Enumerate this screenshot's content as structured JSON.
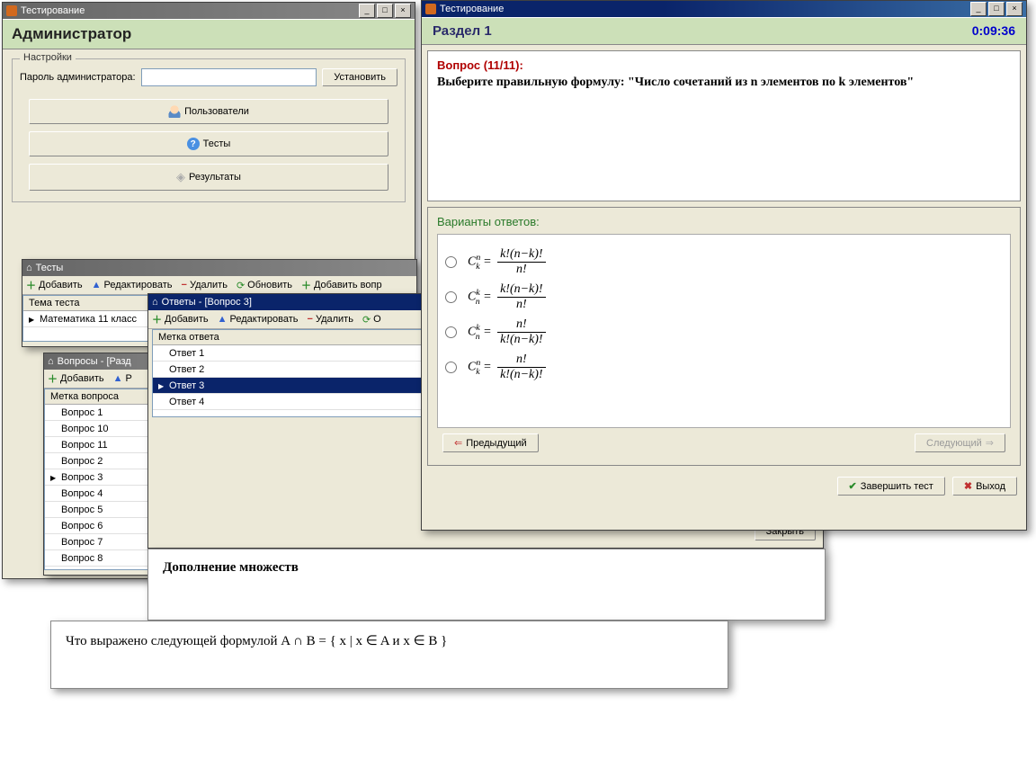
{
  "admin": {
    "title": "Тестирование",
    "header": "Администратор",
    "settings_group": "Настройки",
    "password_label": "Пароль администратора:",
    "set_btn": "Установить",
    "users_btn": "Пользователи",
    "tests_btn": "Тесты",
    "results_btn": "Результаты"
  },
  "tests": {
    "title": "Тесты",
    "tb_add": "Добавить",
    "tb_edit": "Редактировать",
    "tb_del": "Удалить",
    "tb_refresh": "Обновить",
    "tb_addq": "Добавить вопр",
    "col": "Тема теста",
    "row": "Математика 11 класс"
  },
  "questions": {
    "title": "Вопросы - [Разд",
    "tb_add": "Добавить",
    "tb_edit": "Р",
    "col": "Метка вопроса",
    "rows": [
      "Вопрос 1",
      "Вопрос 10",
      "Вопрос 11",
      "Вопрос 2",
      "Вопрос 3",
      "Вопрос 4",
      "Вопрос 5",
      "Вопрос 6",
      "Вопрос 7",
      "Вопрос 8"
    ],
    "selected": "Вопрос 3"
  },
  "answers_win": {
    "title": "Ответы - [Вопрос 3]",
    "tb_add": "Добавить",
    "tb_edit": "Редактировать",
    "tb_del": "Удалить",
    "tb_refresh": "О",
    "col": "Метка ответа",
    "rows": [
      "Ответ 1",
      "Ответ 2",
      "Ответ 3",
      "Ответ 4"
    ],
    "selected": "Ответ 3",
    "close_btn": "Закрыть"
  },
  "extra_panel": "Дополнение множеств",
  "formula_panel": "Что выражено следующей формулой  A ∩ B = { x | x ∈ A и x ∈ B }",
  "test_run": {
    "title": "Тестирование",
    "section": "Раздел 1",
    "timer": "0:09:36",
    "qnum": "Вопрос (11/11):",
    "qtext": "Выберите правильную формулу: \"Число сочетаний из n элементов по k элементов\"",
    "ans_title": "Варианты ответов:",
    "prev_btn": "Предыдущий",
    "next_btn": "Следующий",
    "finish_btn": "Завершить тест",
    "exit_btn": "Выход",
    "answers": [
      {
        "lhs": "C",
        "sup": "n",
        "sub": "k",
        "num": "k!(n−k)!",
        "den": "n!"
      },
      {
        "lhs": "C",
        "sup": "k",
        "sub": "n",
        "num": "k!(n−k)!",
        "den": "n!"
      },
      {
        "lhs": "C",
        "sup": "k",
        "sub": "n",
        "num": "n!",
        "den": "k!(n−k)!"
      },
      {
        "lhs": "C",
        "sup": "n",
        "sub": "k",
        "num": "n!",
        "den": "k!(n−k)!"
      }
    ]
  }
}
